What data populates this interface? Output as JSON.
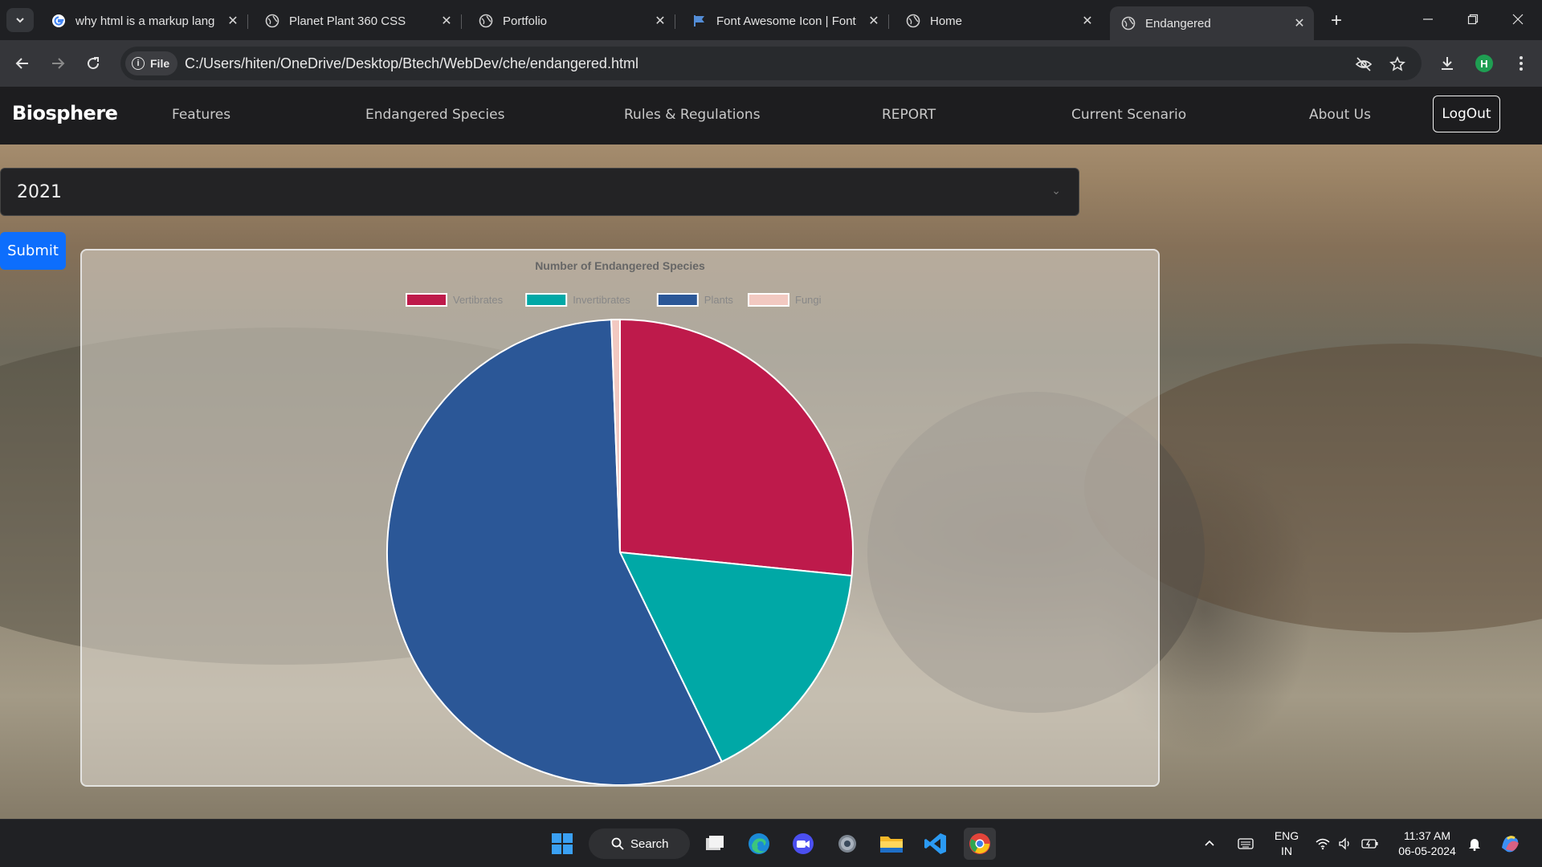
{
  "browser": {
    "tabs": [
      {
        "title": "why html is a markup lang",
        "icon": "google-icon",
        "active": false
      },
      {
        "title": "Planet Plant 360 CSS",
        "icon": "globe-icon",
        "active": false
      },
      {
        "title": "Portfolio",
        "icon": "globe-icon",
        "active": false
      },
      {
        "title": "Font Awesome Icon | Font",
        "icon": "font-awesome-flag-icon",
        "active": false
      },
      {
        "title": "Home",
        "icon": "globe-icon",
        "active": false
      },
      {
        "title": "Endangered",
        "icon": "globe-icon",
        "active": true
      }
    ],
    "address": {
      "chip_label": "File",
      "url": "C:/Users/hiten/OneDrive/Desktop/Btech/WebDev/che/endangered.html"
    },
    "profile_initial": "H"
  },
  "page": {
    "brand": "Biosphere",
    "nav": [
      "Features",
      "Endangered Species",
      "Rules & Regulations",
      "REPORT",
      "Current Scenario",
      "About Us"
    ],
    "logout_label": "LogOut",
    "year_select": {
      "selected": "2021"
    },
    "submit_label": "Submit"
  },
  "chart_data": {
    "type": "pie",
    "title": "Number of Endangered Species",
    "legend_position": "top",
    "categories": [
      "Vertibrates",
      "Invertibrates",
      "Plants",
      "Fungi"
    ],
    "values": [
      26.6,
      16.2,
      56.6,
      0.6
    ],
    "colors": [
      "#be1a4b",
      "#00a8a6",
      "#2b5797",
      "#f2c9c1"
    ]
  },
  "taskbar": {
    "search_label": "Search",
    "language": "ENG",
    "region": "IN",
    "time": "11:37 AM",
    "date": "06-05-2024"
  },
  "colors": {
    "navbar": "#1d1d1f",
    "submit": "#0d6efd",
    "browser_frame": "#35363a"
  }
}
